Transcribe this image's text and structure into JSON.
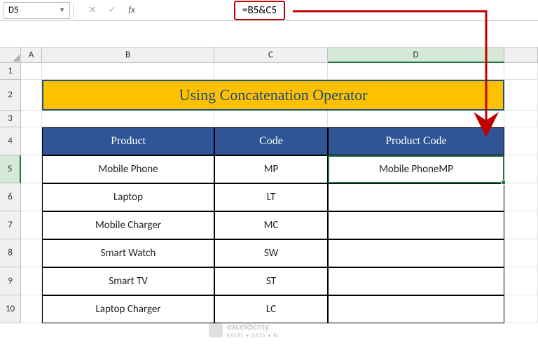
{
  "nameBox": {
    "value": "D5"
  },
  "formulaBar": {
    "value": "=B5&C5"
  },
  "columns": [
    {
      "label": "A",
      "width": "w-A"
    },
    {
      "label": "B",
      "width": "w-B"
    },
    {
      "label": "C",
      "width": "w-C"
    },
    {
      "label": "D",
      "width": "w-D",
      "selected": true
    }
  ],
  "rows": [
    {
      "num": "1",
      "h": "h-1"
    },
    {
      "num": "2",
      "h": "h-2"
    },
    {
      "num": "3",
      "h": "h-3"
    },
    {
      "num": "4",
      "h": "h-4"
    },
    {
      "num": "5",
      "h": "h-data",
      "selected": true
    },
    {
      "num": "6",
      "h": "h-data"
    },
    {
      "num": "7",
      "h": "h-data"
    },
    {
      "num": "8",
      "h": "h-data"
    },
    {
      "num": "9",
      "h": "h-data"
    },
    {
      "num": "10",
      "h": "h-data"
    }
  ],
  "titleBar": "Using Concatenation Operator",
  "tableHeaders": {
    "product": "Product",
    "code": "Code",
    "productCode": "Product Code"
  },
  "data": [
    {
      "product": "Mobile Phone",
      "code": "MP",
      "result": "Mobile PhoneMP"
    },
    {
      "product": "Laptop",
      "code": "LT",
      "result": ""
    },
    {
      "product": "Mobile Charger",
      "code": "MC",
      "result": ""
    },
    {
      "product": "Smart Watch",
      "code": "SW",
      "result": ""
    },
    {
      "product": "Smart TV",
      "code": "ST",
      "result": ""
    },
    {
      "product": "Laptop Charger",
      "code": "LC",
      "result": ""
    }
  ],
  "watermark": {
    "brand": "exceldemy",
    "tagline": "EXCEL • DATA • BI"
  }
}
